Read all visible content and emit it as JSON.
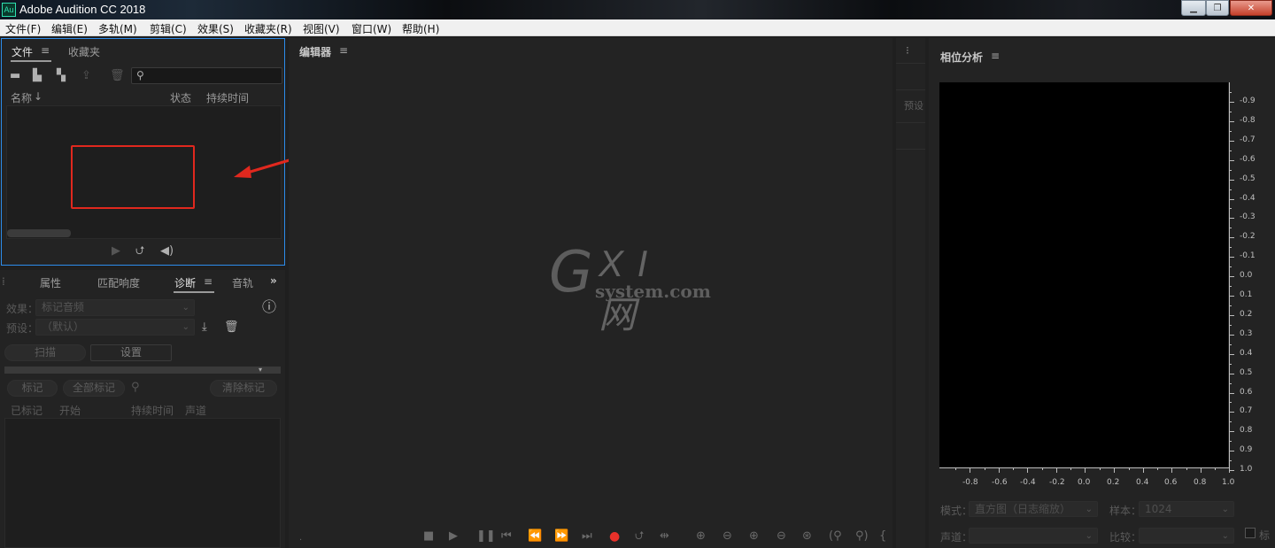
{
  "window": {
    "app_icon": "Au",
    "title": "Adobe Audition CC 2018",
    "controls": [
      "minimize-icon",
      "restore-icon",
      "close-icon"
    ]
  },
  "menubar": {
    "items": [
      "文件(F)",
      "编辑(E)",
      "多轨(M)",
      "剪辑(C)",
      "效果(S)",
      "收藏夹(R)",
      "视图(V)",
      "窗口(W)",
      "帮助(H)"
    ]
  },
  "files_panel": {
    "tabs": [
      "文件",
      "收藏夹"
    ],
    "active_tab": "文件",
    "columns": [
      "名称",
      "状态",
      "持续时间"
    ],
    "sort_arrow": "↓",
    "toolbar_icons": [
      "open-folder-icon",
      "import-icon",
      "new-file-icon",
      "export-icon",
      "delete-icon",
      "search-icon"
    ],
    "transport_icons": [
      "play-icon",
      "loop-icon",
      "autoplay-icon"
    ]
  },
  "diag_panel": {
    "tabs": [
      "属性",
      "匹配响度",
      "诊断",
      "音轨"
    ],
    "active_tab": "诊断",
    "effect_label": "效果：",
    "effect_value": "标记音频",
    "preset_label": "预设：",
    "preset_value": "（默认）",
    "scan_button": "扫描",
    "settings_button": "设置",
    "mark_button": "标记",
    "mark_all_button": "全部标记",
    "clear_marks_button": "清除标记",
    "columns": [
      "已标记",
      "开始",
      "持续时间",
      "声道"
    ]
  },
  "editor": {
    "title": "编辑器",
    "watermark_g": "G",
    "watermark_xi": "X I 网",
    "watermark_site": "system.com",
    "transport": [
      "stop-icon",
      "play-icon",
      "pause-icon",
      "to-start-icon",
      "rewind-icon",
      "fast-forward-icon",
      "to-end-icon",
      "record-icon",
      "loop-icon",
      "skip-icon"
    ],
    "zoom": [
      "zoom-in-amp-icon",
      "zoom-out-amp-icon",
      "zoom-in-time-icon",
      "zoom-out-time-icon",
      "zoom-full-icon",
      "zoom-in-left-icon",
      "zoom-in-right-icon",
      "zoom-selection-icon"
    ]
  },
  "mid_strip": {
    "preset": "预设"
  },
  "phase_panel": {
    "title": "相位分析",
    "y_ticks": [
      "-0.9",
      "-0.8",
      "-0.7",
      "-0.6",
      "-0.5",
      "-0.4",
      "-0.3",
      "-0.2",
      "-0.1",
      "0.0",
      "0.1",
      "0.2",
      "0.3",
      "0.4",
      "0.5",
      "0.6",
      "0.7",
      "0.8",
      "0.9",
      "1.0"
    ],
    "x_ticks": [
      "-0.8",
      "-0.6",
      "-0.4",
      "-0.2",
      "0.0",
      "0.2",
      "0.4",
      "0.6",
      "0.8",
      "1.0"
    ],
    "mode_label": "模式：",
    "mode_value": "直方图（日志缩放）",
    "sample_label": "样本：",
    "sample_value": "1024",
    "channel_label": "声道：",
    "channel_value": "",
    "compare_label": "比较：",
    "compare_value": "",
    "checkbox_label": "标"
  },
  "colors": {
    "background": "#1f1f1f",
    "panel": "#232323",
    "accent_blue": "#2d8ceb",
    "annotation_red": "#e0281e",
    "record_red": "#e8312a"
  }
}
